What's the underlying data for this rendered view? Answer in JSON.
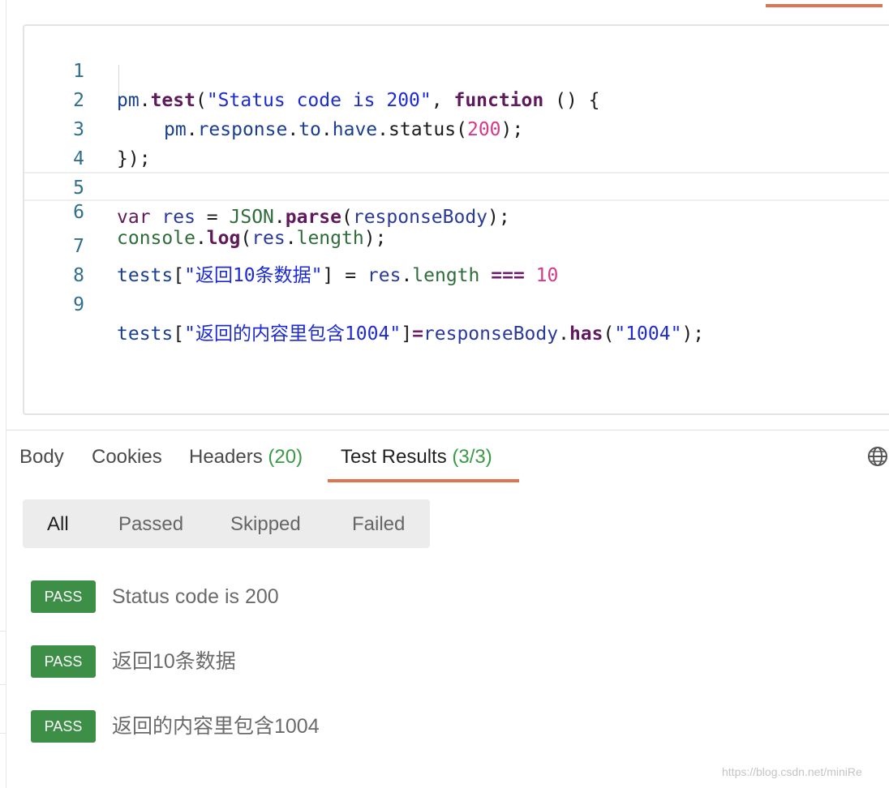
{
  "editor": {
    "lines": [
      {
        "num": "1"
      },
      {
        "num": "2"
      },
      {
        "num": "3"
      },
      {
        "num": "4"
      },
      {
        "num": "5"
      },
      {
        "num": "6"
      },
      {
        "num": "7"
      },
      {
        "num": "8"
      },
      {
        "num": "9"
      }
    ],
    "tokens": {
      "l1": [
        "pm",
        ".",
        "test",
        "(",
        "\"Status code is 200\"",
        ", ",
        "function",
        " () {"
      ],
      "l2": [
        "pm",
        ".",
        "response",
        ".",
        "to",
        ".",
        "have",
        ".",
        "status",
        "(",
        "200",
        ");"
      ],
      "l3": [
        "});"
      ],
      "l5": [
        "var",
        " ",
        "res",
        " = ",
        "JSON",
        ".",
        "parse",
        "(",
        "responseBody",
        ");"
      ],
      "l6": [
        "console",
        ".",
        "log",
        "(",
        "res",
        ".",
        "length",
        ");"
      ],
      "l7": [
        "tests",
        "[",
        "\"返回10条数据\"",
        "] = ",
        "res",
        ".",
        "length",
        " ",
        "===",
        " ",
        "10"
      ],
      "l9": [
        "tests",
        "[",
        "\"返回的内容里包含1004\"",
        "]",
        "=",
        "responseBody",
        ".",
        "has",
        "(",
        "\"1004\"",
        ");"
      ]
    }
  },
  "response_tabs": [
    {
      "label": "Body",
      "count": ""
    },
    {
      "label": "Cookies",
      "count": ""
    },
    {
      "label": "Headers",
      "count": "(20)"
    },
    {
      "label": "Test Results",
      "count": "(3/3)"
    }
  ],
  "selected_tab": "Test Results",
  "filters": [
    "All",
    "Passed",
    "Skipped",
    "Failed"
  ],
  "selected_filter": "All",
  "results": [
    {
      "status": "PASS",
      "name": "Status code is 200"
    },
    {
      "status": "PASS",
      "name": "返回10条数据"
    },
    {
      "status": "PASS",
      "name": "返回的内容里包含1004"
    }
  ],
  "watermark": "https://blog.csdn.net/miniRe",
  "colors": {
    "accent": "#e07451",
    "pass_badge": "#3d8e46",
    "count": "#3a9a45"
  },
  "icons": {
    "language_settings": "globe-icon"
  }
}
